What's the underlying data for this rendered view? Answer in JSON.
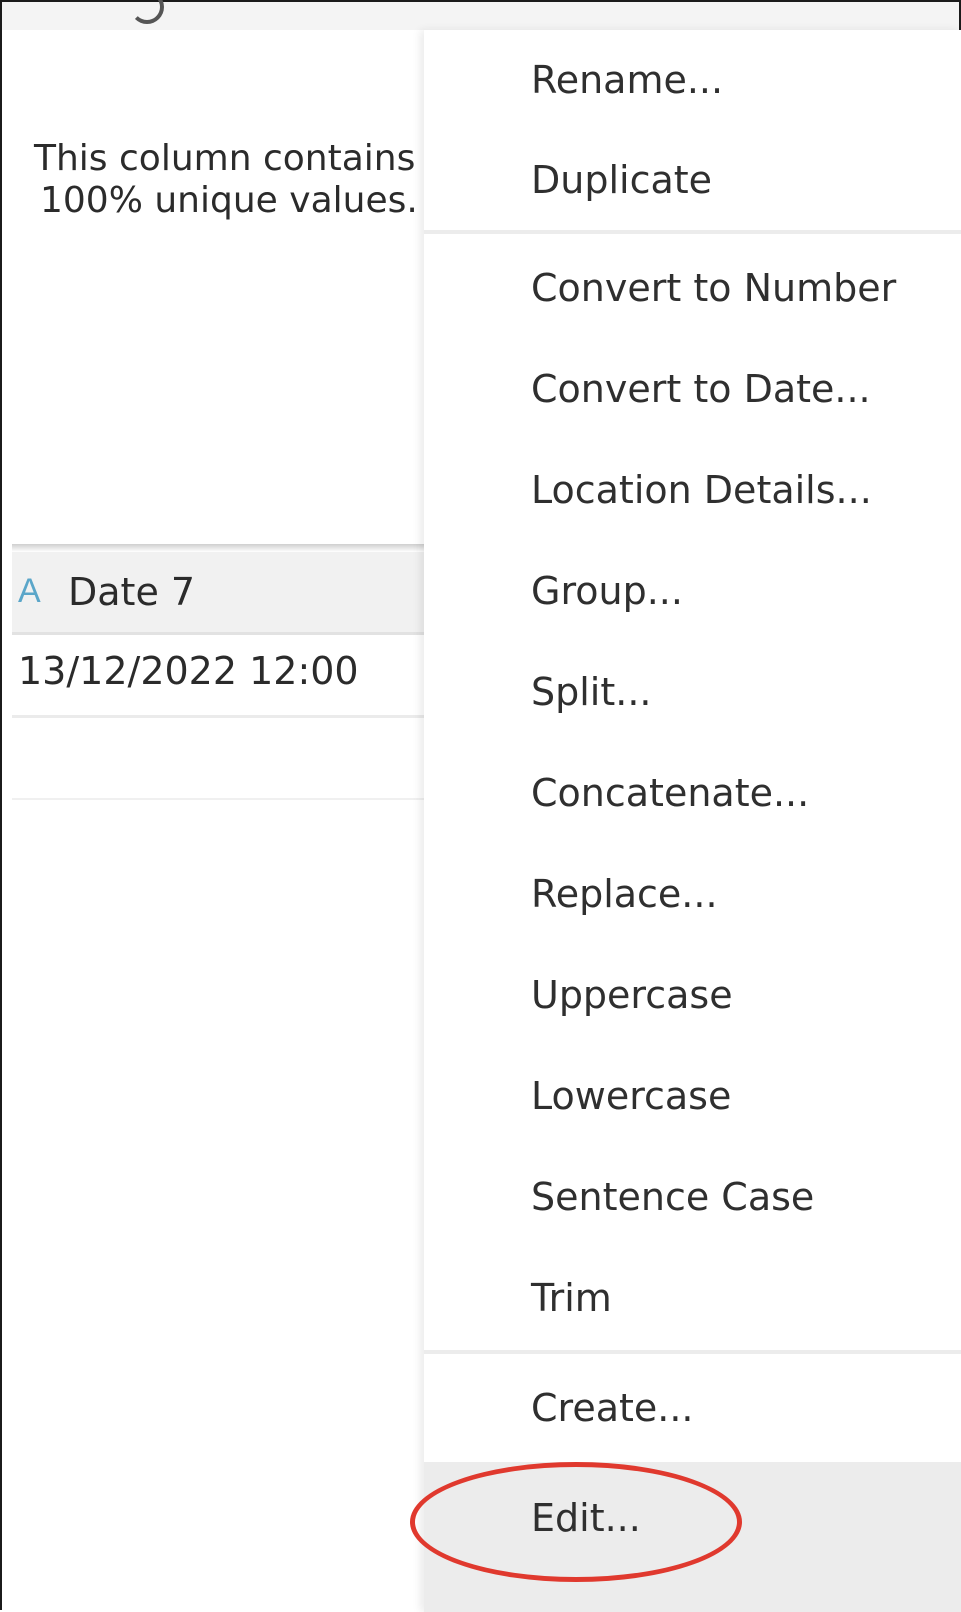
{
  "profile": {
    "line1": "This column contains",
    "line2": "100% unique values."
  },
  "column": {
    "type_icon_glyph": "A",
    "type_icon": "text-type-icon",
    "name": "Date 7",
    "value": "13/12/2022 12:00"
  },
  "menu": {
    "items": [
      {
        "label": "Rename..."
      },
      {
        "label": "Duplicate"
      },
      {
        "label": "Convert to Number"
      },
      {
        "label": "Convert to Date..."
      },
      {
        "label": "Location Details..."
      },
      {
        "label": "Group..."
      },
      {
        "label": "Split..."
      },
      {
        "label": "Concatenate..."
      },
      {
        "label": "Replace..."
      },
      {
        "label": "Uppercase"
      },
      {
        "label": "Lowercase"
      },
      {
        "label": "Sentence Case"
      },
      {
        "label": "Trim"
      },
      {
        "label": "Create..."
      },
      {
        "label": "Edit..."
      }
    ],
    "hovered_item": "Edit..."
  },
  "colors": {
    "accent_type_icon": "#5ba6c9",
    "highlight_annotation": "#e0392e",
    "hover_bg": "#ececec"
  }
}
